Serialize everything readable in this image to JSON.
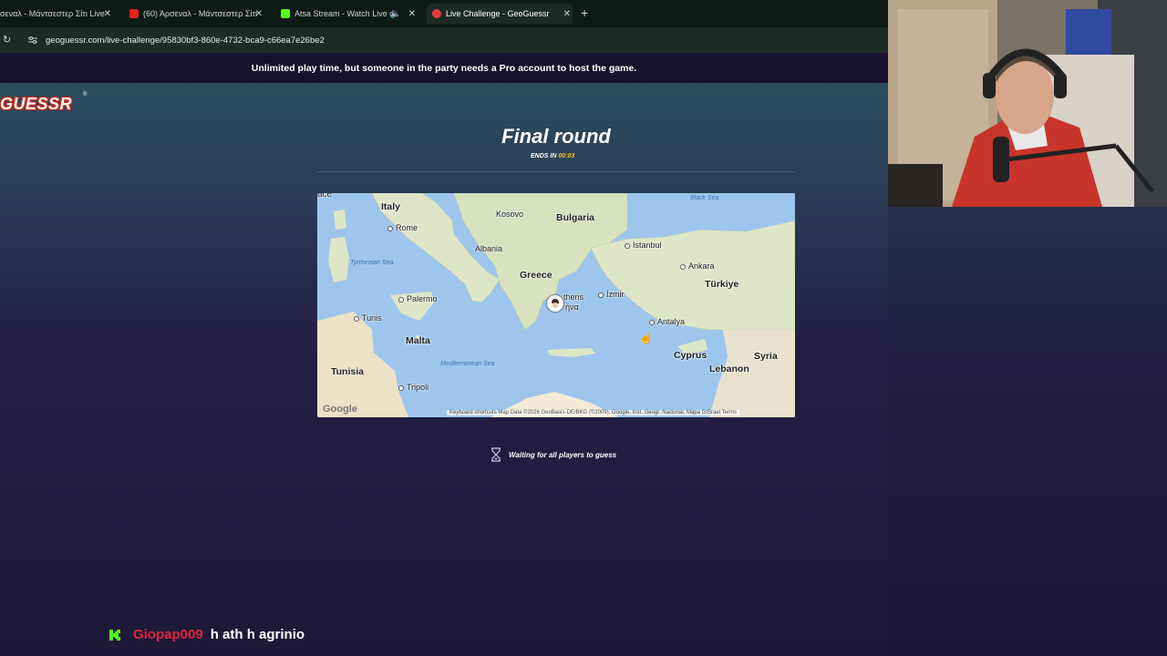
{
  "browser": {
    "tabs": [
      {
        "title": "σεναλ - Μάντσεστερ Σίτι Live"
      },
      {
        "title": "(60) Άρσεναλ - Μάντσεστερ Σίτι"
      },
      {
        "title": "Atsa Stream - Watch Live o"
      },
      {
        "title": "Live Challenge - GeoGuessr"
      }
    ],
    "new_tab": "+",
    "url": "geoguessr.com/live-challenge/95830bf3-860e-4732-bca9-c66ea7e26be2"
  },
  "banner": "Unlimited play time, but someone in the party needs a Pro account to host the game.",
  "logo": "GUESSR",
  "logo_mark": "®",
  "round": {
    "title": "Final round",
    "ends_label": "ENDS IN",
    "ends_time": "00:03"
  },
  "map": {
    "labels": {
      "italy": "Italy",
      "rome": "Rome",
      "kosovo": "Kosovo",
      "bulgaria": "Bulgaria",
      "albania": "Albania",
      "istanbul": "Istanbul",
      "ankara": "Ankara",
      "tyrrhenian": "Tyrrhenian Sea",
      "greece": "Greece",
      "turkiye": "Türkiye",
      "palermo": "Palermo",
      "athens": "thens",
      "athens2": "ήνα",
      "izmir": "İzmir",
      "antalya": "Antalya",
      "tunis": "Tunis",
      "malta": "Malta",
      "cyprus": "Cyprus",
      "syria": "Syria",
      "lebanon": "Lebanon",
      "tunisia": "Tunisia",
      "med": "Mediterranean Sea",
      "tripoli": "Tripoli",
      "black_sea": "Black Sea",
      "ace": "ace",
      "google": "Google"
    },
    "attribution": "Keyboard shortcuts   Map Data ©2026 GeoBasis-DE/BKG (©2009), Google, Inst. Geogr. Nacional, Mapa GISrael   Terms"
  },
  "status": "Waiting for all players to guess",
  "chat": {
    "username": "Giopap009",
    "message": "h ath h agrinio"
  },
  "colors": {
    "accent_yellow": "#f9c232",
    "chat_user": "#e0243a",
    "kick_green": "#53fc18"
  }
}
